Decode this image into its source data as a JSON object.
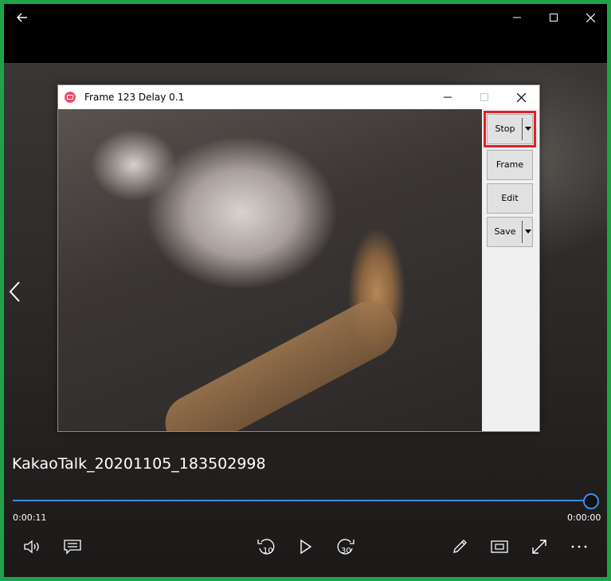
{
  "player": {
    "video_title": "KakaoTalk_20201105_183502998",
    "elapsed": "0:00:11",
    "remaining": "0:00:00",
    "progress_fraction": 1.0,
    "skip_back_seconds": "10",
    "skip_forward_seconds": "30",
    "accent_color": "#3a8ee6"
  },
  "capture_window": {
    "title": "Frame 123 Delay 0.1",
    "buttons": {
      "stop": "Stop",
      "frame": "Frame",
      "edit": "Edit",
      "save": "Save"
    },
    "highlight_color": "#e81d25"
  },
  "icons": [
    "back-arrow-icon",
    "minimize-icon",
    "maximize-icon",
    "close-icon",
    "previous-chevron-icon",
    "volume-icon",
    "subtitles-icon",
    "skip-back-icon",
    "play-icon",
    "skip-forward-icon",
    "pen-icon",
    "mini-view-icon",
    "fullscreen-icon",
    "more-icon"
  ]
}
